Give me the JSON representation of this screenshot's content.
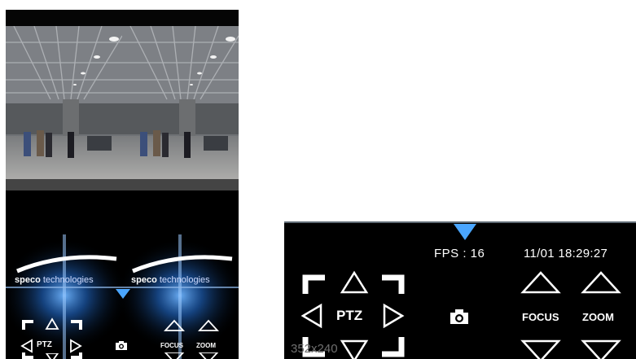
{
  "left_screen": {
    "logo_left": {
      "brand": "speco",
      "suffix": " technologies"
    },
    "logo_right": {
      "brand": "speco",
      "suffix": " technologies"
    },
    "ptz_label": "PTZ",
    "focus_label": "FOCUS",
    "zoom_label": "ZOOM"
  },
  "right_screen": {
    "fps": "FPS : 16",
    "datetime": "11/01 18:29:27",
    "ptz_label": "PTZ",
    "focus_label": "FOCUS",
    "zoom_label": "ZOOM",
    "resolution": "352x240"
  },
  "icons": [
    "collapse-arrow-icon",
    "camera-icon",
    "arrow-up-icon",
    "arrow-down-icon",
    "arrow-left-icon",
    "arrow-right-icon",
    "corner-arrow-icon"
  ],
  "colors": {
    "accent_blue": "#4aa6ff",
    "background": "#000000",
    "text": "#ffffff"
  }
}
